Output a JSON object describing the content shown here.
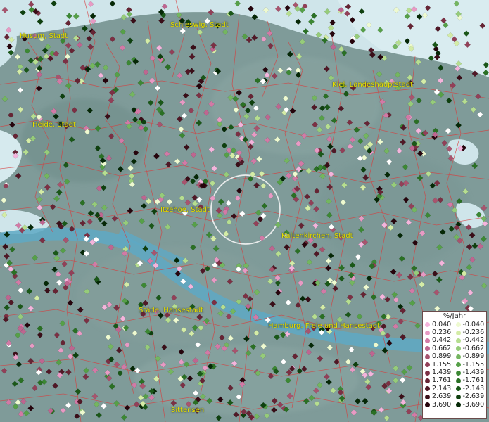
{
  "cities": [
    {
      "name": "Husum, Stadt"
    },
    {
      "name": "Schleswig, Stadt"
    },
    {
      "name": "Kiel, Landeshauptstadt"
    },
    {
      "name": "Heide, Stadt"
    },
    {
      "name": "Itzehoe, Stadt"
    },
    {
      "name": "Kaltenkirchen, Stadt"
    },
    {
      "name": "Stade, Hansestadt"
    },
    {
      "name": "Hamburg, Freie und Hansestadt"
    },
    {
      "name": "Sittensen"
    }
  ],
  "legend": {
    "title": "%/Jahr",
    "positive": [
      {
        "label": "0.040",
        "color": "#f4b4dc"
      },
      {
        "label": "0.236",
        "color": "#e89ac4"
      },
      {
        "label": "0.442",
        "color": "#d27aa6"
      },
      {
        "label": "0.662",
        "color": "#be6690"
      },
      {
        "label": "0.899",
        "color": "#a8546e"
      },
      {
        "label": "1.155",
        "color": "#924058"
      },
      {
        "label": "1.439",
        "color": "#7c3044"
      },
      {
        "label": "1.761",
        "color": "#662434"
      },
      {
        "label": "2.143",
        "color": "#501826"
      },
      {
        "label": "2.639",
        "color": "#3a0e18"
      },
      {
        "label": "3.690",
        "color": "#26040c"
      }
    ],
    "negative": [
      {
        "label": "-0.040",
        "color": "#eefad0"
      },
      {
        "label": "-0.236",
        "color": "#d4eca6"
      },
      {
        "label": "-0.442",
        "color": "#b6de90"
      },
      {
        "label": "-0.662",
        "color": "#96cc7a"
      },
      {
        "label": "-0.899",
        "color": "#74b660"
      },
      {
        "label": "-1.155",
        "color": "#56a048"
      },
      {
        "label": "-1.439",
        "color": "#3c8834"
      },
      {
        "label": "-1.761",
        "color": "#2a7024"
      },
      {
        "label": "-2.143",
        "color": "#1a5818"
      },
      {
        "label": "-2.639",
        "color": "#0e400e"
      },
      {
        "label": "-3.690",
        "color": "#052806"
      }
    ]
  }
}
